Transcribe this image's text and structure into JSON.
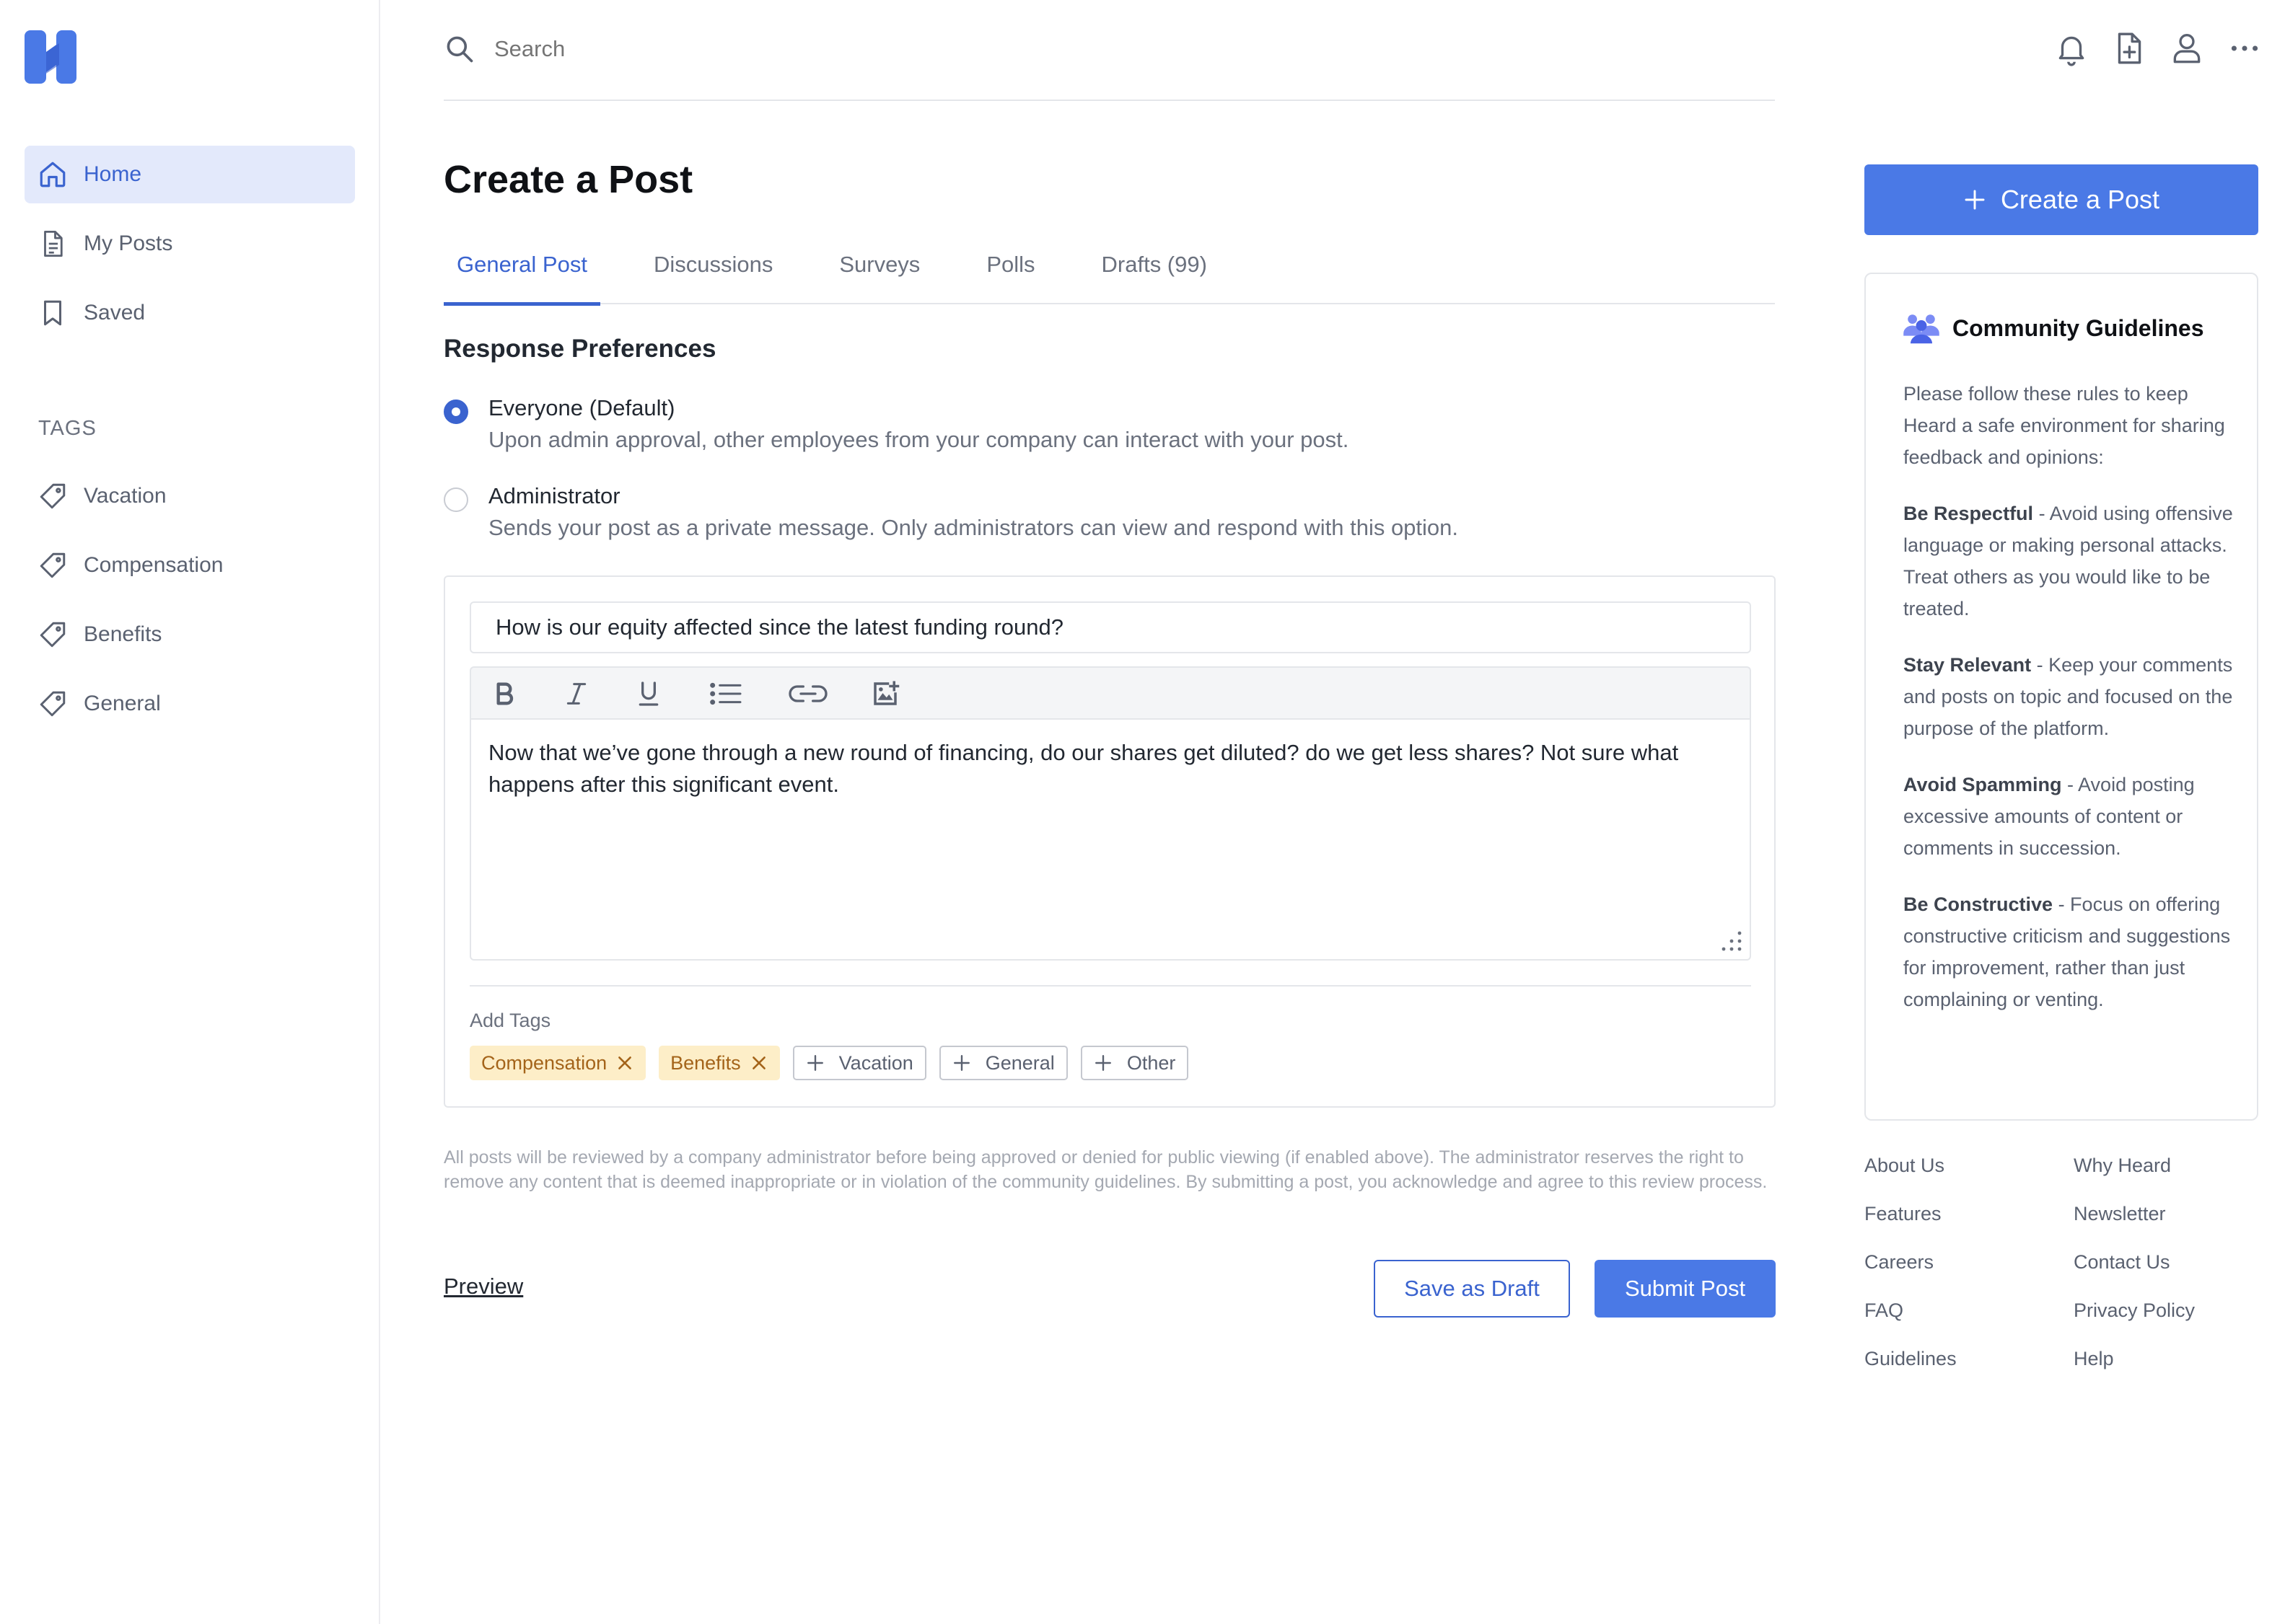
{
  "brand": {
    "accent": "#4a79e6",
    "accent_dark": "#3a63cf",
    "logo_icon": "heard-h-logo"
  },
  "sidebar": {
    "nav": [
      {
        "label": "Home",
        "icon": "home-icon",
        "active": true
      },
      {
        "label": "My Posts",
        "icon": "document-icon",
        "active": false
      },
      {
        "label": "Saved",
        "icon": "bookmark-icon",
        "active": false
      }
    ],
    "tags_heading": "TAGS",
    "tags": [
      {
        "label": "Vacation",
        "icon": "tag-icon"
      },
      {
        "label": "Compensation",
        "icon": "tag-icon"
      },
      {
        "label": "Benefits",
        "icon": "tag-icon"
      },
      {
        "label": "General",
        "icon": "tag-icon"
      }
    ]
  },
  "topbar": {
    "search_placeholder": "Search",
    "icons": [
      "bell-icon",
      "new-document-icon",
      "user-icon",
      "more-icon"
    ]
  },
  "main": {
    "title": "Create a Post",
    "tabs": [
      {
        "label": "General Post",
        "active": true
      },
      {
        "label": "Discussions",
        "active": false
      },
      {
        "label": "Surveys",
        "active": false
      },
      {
        "label": "Polls",
        "active": false
      },
      {
        "label": "Drafts (99)",
        "active": false
      }
    ],
    "response_heading": "Response Preferences",
    "options": [
      {
        "title": "Everyone (Default)",
        "desc": "Upon admin approval, other employees from your company can interact with your post.",
        "checked": true
      },
      {
        "title": "Administrator",
        "desc": "Sends your post as a private message. Only administrators can view and respond with this option.",
        "checked": false
      }
    ],
    "editor": {
      "subject": "How is our equity affected since the latest funding round?",
      "toolbar": [
        "bold-icon",
        "italic-icon",
        "underline-icon",
        "list-icon",
        "link-icon",
        "image-icon"
      ],
      "body": "Now that we’ve gone through a new round of financing, do our shares get diluted? do we get less shares? Not sure what happens after this significant event.",
      "add_tags_label": "Add Tags",
      "selected_tags": [
        "Compensation",
        "Benefits"
      ],
      "available_tags": [
        "Vacation",
        "General",
        "Other"
      ]
    },
    "disclaimer": "All posts will be reviewed by a company administrator before being approved or denied for public viewing (if enabled above). The administrator reserves the right to remove any content that is deemed inappropriate or in violation of the community guidelines. By submitting a post, you acknowledge and agree to this review process.",
    "preview_label": "Preview",
    "save_draft_label": "Save as Draft",
    "submit_label": "Submit Post"
  },
  "right": {
    "create_button": "Create a Post",
    "guidelines": {
      "title": "Community Guidelines",
      "icon": "community-icon",
      "intro": "Please follow these rules to keep Heard a safe environment for sharing feedback and opinions:",
      "rules": [
        {
          "name": "Be Respectful",
          "text": " - Avoid using offensive language or making personal attacks. Treat others as you would like to be treated."
        },
        {
          "name": "Stay Relevant",
          "text": " - Keep your comments and posts on topic and focused on the purpose of the platform."
        },
        {
          "name": "Avoid Spamming",
          "text": " - Avoid posting excessive amounts of content or comments in succession."
        },
        {
          "name": "Be Constructive",
          "text": " - Focus on offering constructive criticism and suggestions for improvement, rather than just complaining or venting."
        }
      ]
    },
    "footer_links": [
      "About Us",
      "Why Heard",
      "Features",
      "Newsletter",
      "Careers",
      "Contact Us",
      "FAQ",
      "Privacy Policy",
      "Guidelines",
      "Help"
    ]
  }
}
